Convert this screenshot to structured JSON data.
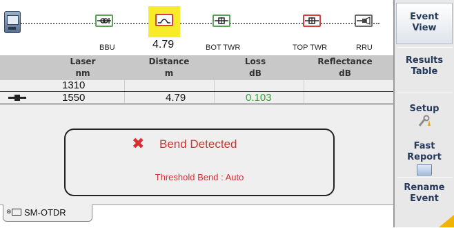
{
  "events": {
    "bbu_label": "BBU",
    "distance_label": "4.79",
    "bot_twr_label": "BOT TWR",
    "top_twr_label": "TOP TWR",
    "rru_label": "RRU"
  },
  "table": {
    "headers": [
      {
        "name": "Laser",
        "unit": "nm"
      },
      {
        "name": "Distance",
        "unit": "m"
      },
      {
        "name": "Loss",
        "unit": "dB"
      },
      {
        "name": "Reflectance",
        "unit": "dB"
      }
    ],
    "rows": [
      {
        "laser": "1310",
        "distance": "",
        "loss": "",
        "reflectance": ""
      },
      {
        "laser": "1550",
        "distance": "4.79",
        "loss": "0.103",
        "reflectance": ""
      }
    ]
  },
  "alert": {
    "title": "Bend Detected",
    "threshold": "Threshold Bend : Auto"
  },
  "tab": {
    "label": "SM-OTDR"
  },
  "side_menu": {
    "event_view": [
      "Event",
      "View"
    ],
    "results_table": [
      "Results",
      "Table"
    ],
    "setup": "Setup",
    "fast_report": [
      "Fast",
      "Report"
    ],
    "rename_event": [
      "Rename",
      "Event"
    ]
  },
  "colors": {
    "selected_event": "#f7eb2a",
    "loss_value": "#3aa03a",
    "alert_text": "#d63030",
    "menu_text": "#263a5c"
  }
}
